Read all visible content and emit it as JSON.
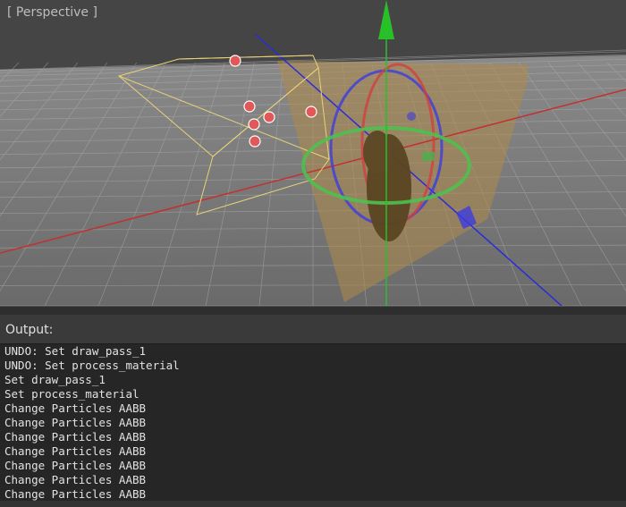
{
  "viewport": {
    "label": "[ Perspective ]",
    "colors": {
      "axis_x": "#c23030",
      "axis_y": "#28c028",
      "axis_z": "#2b2bd6",
      "selection_box": "#e8d27a",
      "handle": "#e05858"
    }
  },
  "output": {
    "title": "Output:",
    "lines": [
      "UNDO: Set draw_pass_1",
      "UNDO: Set process_material",
      "Set draw_pass_1",
      "Set process_material",
      "Change Particles AABB",
      "Change Particles AABB",
      "Change Particles AABB",
      "Change Particles AABB",
      "Change Particles AABB",
      "Change Particles AABB",
      "Change Particles AABB"
    ]
  }
}
